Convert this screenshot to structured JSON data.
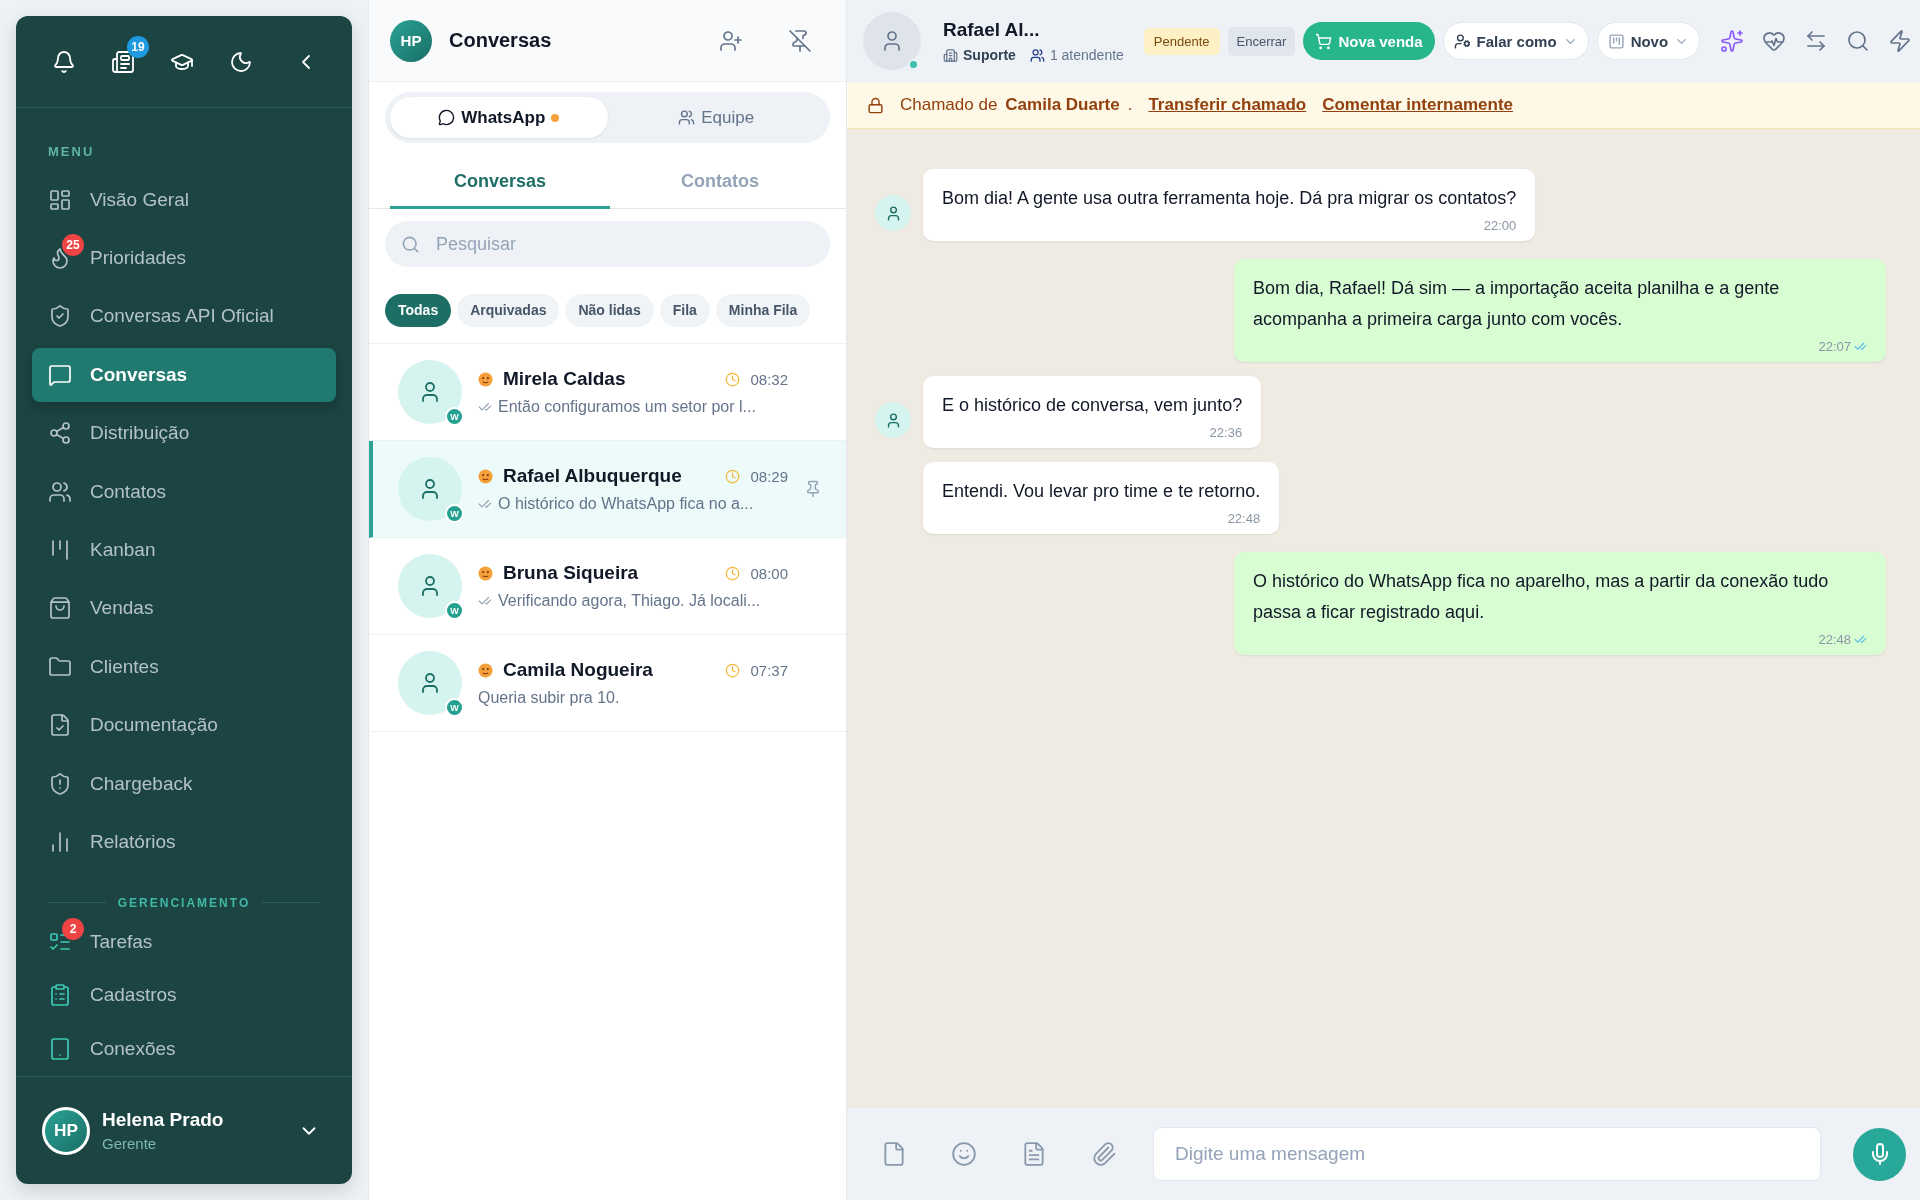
{
  "sidebar": {
    "news_badge": "19",
    "sections": [
      {
        "label": "MENU",
        "items": [
          {
            "label": "Visão Geral",
            "selected": false
          },
          {
            "label": "Prioridades",
            "selected": false,
            "badge": "25"
          },
          {
            "label": "Conversas API Oficial",
            "selected": false
          },
          {
            "label": "Conversas",
            "selected": true
          },
          {
            "label": "Distribuição",
            "selected": false
          },
          {
            "label": "Contatos",
            "selected": false
          },
          {
            "label": "Kanban",
            "selected": false
          },
          {
            "label": "Vendas",
            "selected": false
          },
          {
            "label": "Clientes",
            "selected": false
          },
          {
            "label": "Documentação",
            "selected": false
          },
          {
            "label": "Chargeback",
            "selected": false
          },
          {
            "label": "Relatórios",
            "selected": false
          }
        ]
      },
      {
        "label": "GERENCIAMENTO",
        "items": [
          {
            "label": "Tarefas",
            "selected": false,
            "badge": "2"
          },
          {
            "label": "Cadastros",
            "selected": false
          },
          {
            "label": "Conexões",
            "selected": false
          }
        ]
      }
    ],
    "user": {
      "initials": "HP",
      "name": "Helena Prado",
      "role": "Gerente"
    }
  },
  "conversations_panel": {
    "avatar": "HP",
    "title": "Conversas",
    "channels": [
      {
        "label": "WhatsApp",
        "selected": true,
        "indicator": true
      },
      {
        "label": "Equipe",
        "selected": false,
        "indicator": false
      }
    ],
    "tabs": [
      {
        "label": "Conversas",
        "selected": true
      },
      {
        "label": "Contatos",
        "selected": false
      }
    ],
    "search": {
      "placeholder": "Pesquisar"
    },
    "filters": [
      {
        "label": "Todas",
        "selected": true
      },
      {
        "label": "Arquivadas",
        "selected": false
      },
      {
        "label": "Não lidas",
        "selected": false
      },
      {
        "label": "Fila",
        "selected": false
      },
      {
        "label": "Minha Fila",
        "selected": false
      }
    ],
    "items": [
      {
        "name": "Mirela Caldas",
        "time": "08:32",
        "preview": "Então configuramos um setor por l...",
        "read_receipt": true,
        "selected": false,
        "pinned": false,
        "channel": "W"
      },
      {
        "name": "Rafael Albuquerque",
        "time": "08:29",
        "preview": "O histórico do WhatsApp fica no a...",
        "read_receipt": true,
        "selected": true,
        "pinned": true,
        "channel": "W"
      },
      {
        "name": "Bruna Siqueira",
        "time": "08:00",
        "preview": "Verificando agora, Thiago. Já locali...",
        "read_receipt": true,
        "selected": false,
        "pinned": false,
        "channel": "W"
      },
      {
        "name": "Camila Nogueira",
        "time": "07:37",
        "preview": "Queria subir pra 10.",
        "read_receipt": false,
        "selected": false,
        "pinned": false,
        "channel": "W"
      }
    ]
  },
  "chat": {
    "contact": {
      "name": "Rafael Al...",
      "department": "Suporte",
      "agents": "1 atendente"
    },
    "status_badge": "Pendente",
    "close_button": "Encerrar",
    "sale_button": "Nova venda",
    "dropdowns": [
      "Falar como",
      "Novo"
    ],
    "banner": {
      "text": "Chamado de **Camila Duarte** .",
      "links": [
        "Transferir chamado",
        "Comentar internamente"
      ]
    },
    "messages": [
      {
        "kind": "incoming",
        "show_avatar": true,
        "text": "Bom dia! A gente usa outra ferramenta hoje. Dá pra migrar os contatos?",
        "time": "22:00"
      },
      {
        "kind": "outgoing",
        "text": "Bom dia, Rafael! Dá sim — a importação aceita planilha e a gente acompanha a primeira carga junto com vocês.",
        "time": "22:07"
      },
      {
        "kind": "incoming",
        "show_avatar": true,
        "text": "E o histórico de conversa, vem junto?",
        "time": "22:36"
      },
      {
        "kind": "incoming",
        "show_avatar": false,
        "text": "Entendi. Vou levar pro time e te retorno.",
        "time": "22:48"
      },
      {
        "kind": "outgoing",
        "text": "O histórico do WhatsApp fica no aparelho, mas a partir da conexão tudo passa a ficar registrado aqui.",
        "time": "22:48"
      }
    ],
    "composer": {
      "placeholder": "Digite uma mensagem"
    }
  }
}
